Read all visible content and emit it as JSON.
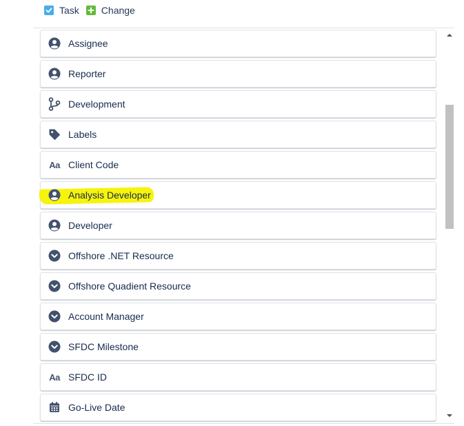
{
  "legend": {
    "task_label": "Task",
    "change_label": "Change"
  },
  "fields": [
    {
      "label": "Assignee",
      "icon": "user-avatar-icon",
      "highlighted": false
    },
    {
      "label": "Reporter",
      "icon": "user-avatar-icon",
      "highlighted": false
    },
    {
      "label": "Development",
      "icon": "branch-icon",
      "highlighted": false
    },
    {
      "label": "Labels",
      "icon": "tag-icon",
      "highlighted": false
    },
    {
      "label": "Client Code",
      "icon": "text-aa-icon",
      "highlighted": false
    },
    {
      "label": "Analysis Developer",
      "icon": "user-avatar-icon",
      "highlighted": true
    },
    {
      "label": "Developer",
      "icon": "user-avatar-icon",
      "highlighted": false
    },
    {
      "label": "Offshore .NET Resource",
      "icon": "dropdown-circle-icon",
      "highlighted": false
    },
    {
      "label": "Offshore Quadient Resource",
      "icon": "dropdown-circle-icon",
      "highlighted": false
    },
    {
      "label": "Account Manager",
      "icon": "dropdown-circle-icon",
      "highlighted": false
    },
    {
      "label": "SFDC Milestone",
      "icon": "dropdown-circle-icon",
      "highlighted": false
    },
    {
      "label": "SFDC ID",
      "icon": "text-aa-icon",
      "highlighted": false
    },
    {
      "label": "Go-Live Date",
      "icon": "calendar-icon",
      "highlighted": false
    }
  ],
  "colors": {
    "task": "#4bade8",
    "change": "#63ba3c",
    "icon": "#42526e",
    "highlight": "#f5f200",
    "text": "#172b4d"
  },
  "icon_glyphs": {
    "text_aa": "Aa"
  }
}
